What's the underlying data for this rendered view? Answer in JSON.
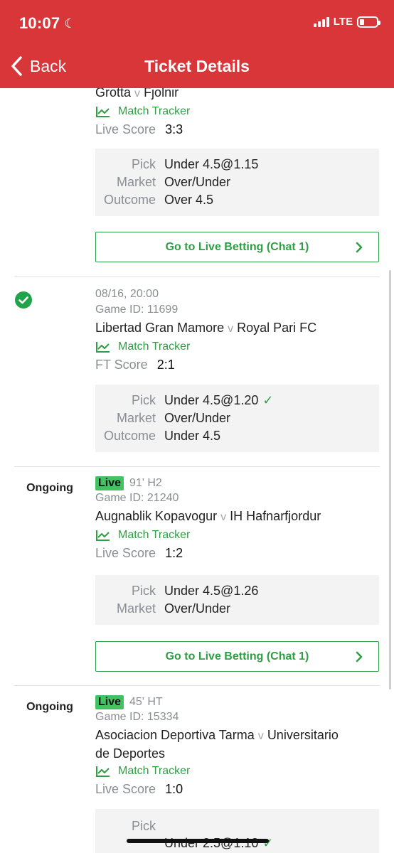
{
  "status_bar": {
    "time": "10:07",
    "network": "LTE"
  },
  "nav": {
    "back_label": "Back",
    "title": "Ticket Details"
  },
  "matches": [
    {
      "home": "Grotta",
      "vs": "v",
      "away": "Fjolnir",
      "tracker": "Match Tracker",
      "score_label": "Live Score",
      "score": "3:3",
      "pick_label": "Pick",
      "pick": "Under 4.5@1.15",
      "market_label": "Market",
      "market": "Over/Under",
      "outcome_label": "Outcome",
      "outcome": "Over 4.5",
      "button": "Go to Live Betting (Chat 1)"
    },
    {
      "datetime": "08/16, 20:00",
      "game_id": "Game ID: 11699",
      "home": "Libertad Gran Mamore",
      "vs": "v",
      "away": "Royal Pari FC",
      "tracker": "Match Tracker",
      "score_label": "FT Score",
      "score": "2:1",
      "pick_label": "Pick",
      "pick": "Under 4.5@1.20",
      "market_label": "Market",
      "market": "Over/Under",
      "outcome_label": "Outcome",
      "outcome": "Under 4.5",
      "tick": "✓"
    },
    {
      "state": "Ongoing",
      "live": "Live",
      "live_time": "91' H2",
      "game_id": "Game ID: 21240",
      "home": "Augnablik Kopavogur",
      "vs": "v",
      "away": "IH Hafnarfjordur",
      "tracker": "Match Tracker",
      "score_label": "Live Score",
      "score": "1:2",
      "pick_label": "Pick",
      "pick": "Under 4.5@1.26",
      "market_label": "Market",
      "market": "Over/Under",
      "button": "Go to Live Betting (Chat 1)"
    },
    {
      "state": "Ongoing",
      "live": "Live",
      "live_time": "45' HT",
      "game_id": "Game ID: 15334",
      "home": "Asociacion Deportiva Tarma",
      "vs": "v",
      "away_line1": "Universitario",
      "away_line2": "de Deportes",
      "tracker": "Match Tracker",
      "score_label": "Live Score",
      "score": "1:0",
      "pick_label": "Pick",
      "pick": "Under 2.5@1.10",
      "tick": "✓"
    }
  ],
  "colors": {
    "header": "#d9363a",
    "accent_green": "#2f9e44",
    "live_badge": "#43c263"
  },
  "icons": [
    "moon-icon",
    "cellular-signal-icon",
    "battery-icon",
    "back-chevron-icon",
    "match-tracker-chart-icon",
    "chevron-right-icon",
    "check-circle-icon",
    "checkmark-icon"
  ]
}
